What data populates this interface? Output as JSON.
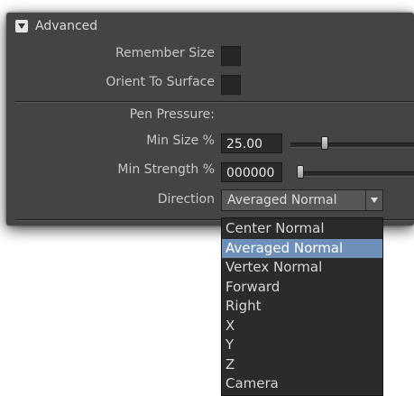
{
  "section": {
    "title": "Advanced",
    "toggle_icon": "triangle-down-icon"
  },
  "fields": {
    "remember_size_label": "Remember Size",
    "orient_to_surface_label": "Orient To Surface",
    "pen_pressure_label": "Pen Pressure:",
    "min_size_label": "Min Size %",
    "min_size_value": "25.00",
    "min_size_slider_fraction": 0.25,
    "min_strength_label": "Min Strength %",
    "min_strength_value": "000000",
    "min_strength_slider_fraction": 0.0,
    "direction_label": "Direction",
    "direction_value": "Averaged Normal"
  },
  "menu": {
    "items": [
      {
        "label": "Center Normal"
      },
      {
        "label": "Averaged Normal"
      },
      {
        "label": "Vertex Normal"
      },
      {
        "label": "Forward"
      },
      {
        "label": "Right"
      },
      {
        "label": "X"
      },
      {
        "label": "Y"
      },
      {
        "label": "Z"
      },
      {
        "label": "Camera"
      }
    ],
    "selected": "Averaged Normal"
  },
  "colors": {
    "panel": "#444444",
    "selection": "#6d8fb8"
  }
}
